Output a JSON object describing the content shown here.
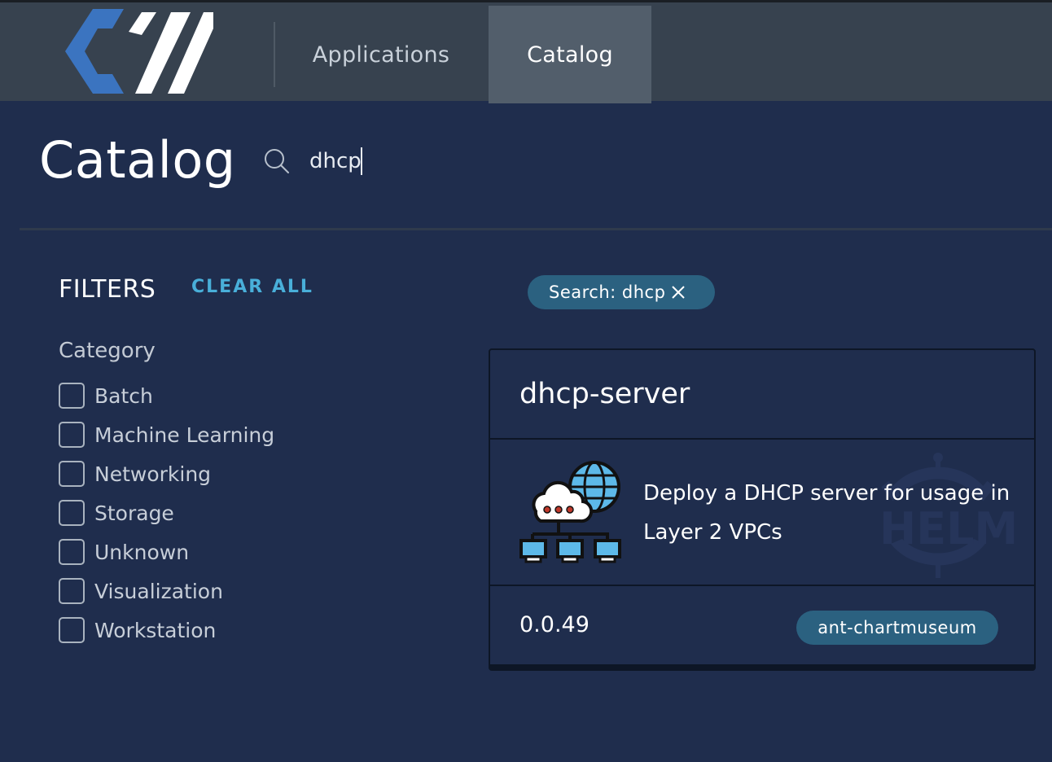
{
  "topbar": {
    "logo_name": "cw-logo",
    "tabs": [
      {
        "label": "Applications",
        "active": false
      },
      {
        "label": "Catalog",
        "active": true
      }
    ]
  },
  "page": {
    "title": "Catalog",
    "search": {
      "value": "dhcp",
      "icon": "search-icon"
    }
  },
  "filters": {
    "title": "FILTERS",
    "clear_all": "CLEAR ALL",
    "category_title": "Category",
    "categories": [
      {
        "label": "Batch",
        "checked": false
      },
      {
        "label": "Machine Learning",
        "checked": false
      },
      {
        "label": "Networking",
        "checked": false
      },
      {
        "label": "Storage",
        "checked": false
      },
      {
        "label": "Unknown",
        "checked": false
      },
      {
        "label": "Visualization",
        "checked": false
      },
      {
        "label": "Workstation",
        "checked": false
      }
    ]
  },
  "active_filter_chip": {
    "label": "Search: dhcp",
    "icon": "close-icon"
  },
  "results": [
    {
      "name": "dhcp-server",
      "description": "Deploy a DHCP server for usage in Layer 2 VPCs",
      "version": "0.0.49",
      "repository": "ant-chartmuseum",
      "icon": "network-cloud-icon",
      "watermark": "helm-icon"
    }
  ],
  "colors": {
    "topbar": "#37424f",
    "active_tab": "#525e6b",
    "background": "#1f2d4d",
    "accent_link": "#49afd9",
    "chip": "#2b6180"
  }
}
